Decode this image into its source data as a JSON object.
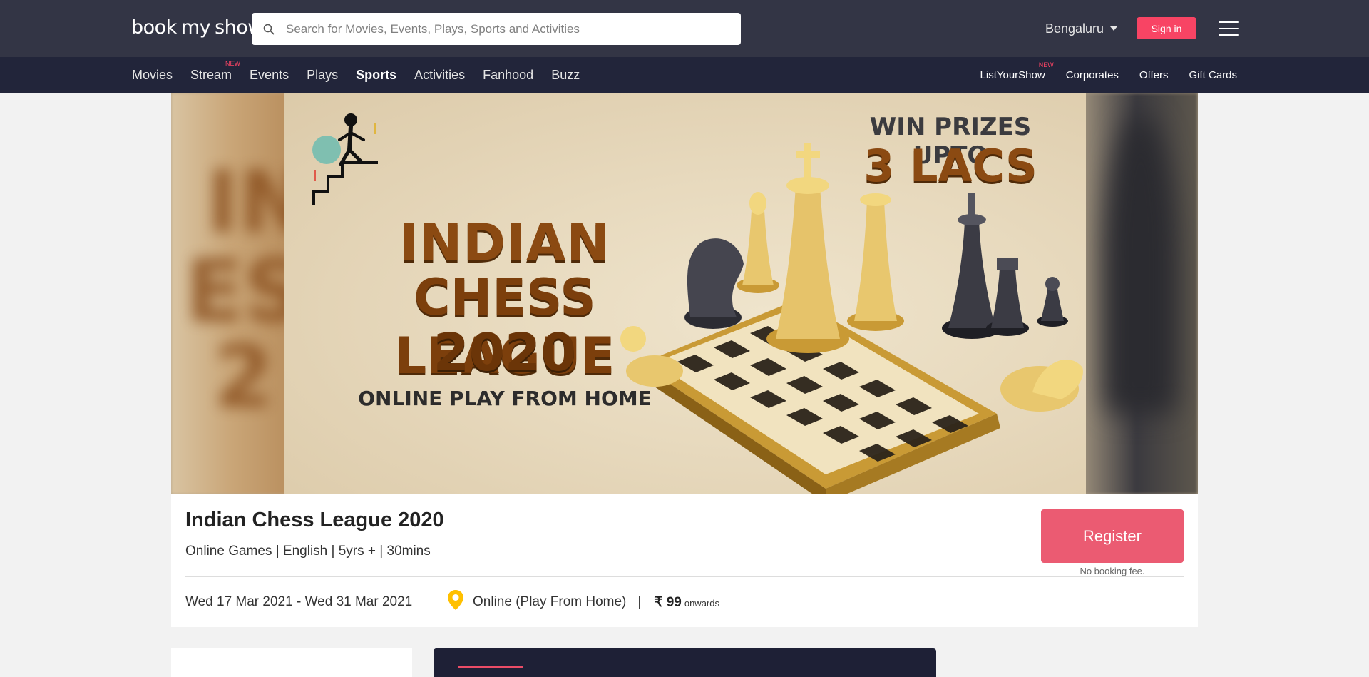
{
  "header": {
    "logo": {
      "part1": "book",
      "part2": "my",
      "part3": "show"
    },
    "search_placeholder": "Search for Movies, Events, Plays, Sports and Activities",
    "city": "Bengaluru",
    "sign_in": "Sign in"
  },
  "nav": {
    "left": [
      {
        "label": "Movies"
      },
      {
        "label": "Stream",
        "tag": "NEW"
      },
      {
        "label": "Events"
      },
      {
        "label": "Plays"
      },
      {
        "label": "Sports",
        "active": true
      },
      {
        "label": "Activities"
      },
      {
        "label": "Fanhood"
      },
      {
        "label": "Buzz"
      }
    ],
    "right": [
      {
        "label": "ListYourShow",
        "tag": "NEW"
      },
      {
        "label": "Corporates"
      },
      {
        "label": "Offers"
      },
      {
        "label": "Gift Cards"
      }
    ]
  },
  "banner": {
    "line1": "INDIAN",
    "line2": "CHESS LEAGUE",
    "line3": "2020",
    "line4": "ONLINE PLAY FROM HOME",
    "prize_line1": "WIN PRIZES UPTO",
    "prize_line2": "3 LACS"
  },
  "event": {
    "title": "Indian Chess League 2020",
    "meta": "Online Games | English | 5yrs + | 30mins",
    "register": "Register",
    "fee_note": "No booking fee.",
    "dates": "Wed 17 Mar 2021 - Wed 31 Mar 2021",
    "venue": "Online (Play From Home)",
    "separator": "|",
    "price": "₹ 99",
    "price_suffix": "onwards"
  },
  "colors": {
    "header_bg": "#333545",
    "nav_bg": "#22253a",
    "accent": "#f84464",
    "register_bg": "#eb5b72",
    "pin": "#ffc000"
  }
}
